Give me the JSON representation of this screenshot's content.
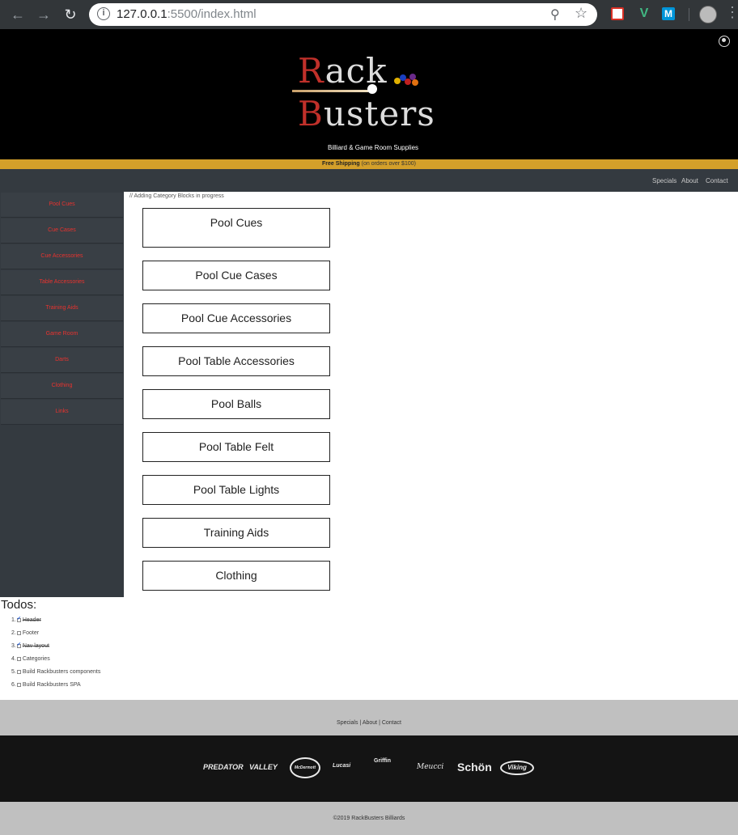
{
  "browser": {
    "url_host": "127.0.0.1",
    "url_path": ":5500/index.html"
  },
  "header": {
    "logo_word1": "Rack",
    "logo_word2": "Busters",
    "tagline": "Billiard & Game Room Supplies"
  },
  "shipping": {
    "bold": "Free Shipping",
    "rest": " (on orders over $100)"
  },
  "topnav": [
    "Specials",
    "About",
    "Contact"
  ],
  "sidebar": {
    "items": [
      {
        "label": "Pool Cues"
      },
      {
        "label": "Cue Cases"
      },
      {
        "label": "Cue Accessories"
      },
      {
        "label": "Table Accessories"
      },
      {
        "label": "Training Aids"
      },
      {
        "label": "Game Room"
      },
      {
        "label": "Darts"
      },
      {
        "label": "Clothing"
      },
      {
        "label": "Links"
      }
    ]
  },
  "main": {
    "progress_note": "// Adding Category Blocks in progress",
    "categories": [
      {
        "label": "Pool Cues"
      },
      {
        "label": "Pool Cue Cases"
      },
      {
        "label": "Pool Cue Accessories"
      },
      {
        "label": "Pool Table Accessories"
      },
      {
        "label": "Pool Balls"
      },
      {
        "label": "Pool Table Felt"
      },
      {
        "label": "Pool Table Lights"
      },
      {
        "label": "Training Aids"
      },
      {
        "label": "Clothing"
      }
    ]
  },
  "todos": {
    "title": "Todos:",
    "items": [
      {
        "num": "1.",
        "label": "Header",
        "done": true
      },
      {
        "num": "2.",
        "label": "Footer",
        "done": false
      },
      {
        "num": "3.",
        "label": "Nav layout",
        "done": true
      },
      {
        "num": "4.",
        "label": "Categories",
        "done": false
      },
      {
        "num": "5.",
        "label": "Build Rackbusters components",
        "done": false
      },
      {
        "num": "6.",
        "label": "Build Rackbusters SPA",
        "done": false
      }
    ]
  },
  "footer": {
    "links": [
      "Specials",
      "About",
      "Contact"
    ],
    "brands": [
      "PREDATOR",
      "VALLEY",
      "McDermott",
      "Lucasi",
      "Griffin",
      "Meucci",
      "Schön",
      "Viking"
    ],
    "copyright": "©2019 RackBusters Billiards"
  }
}
